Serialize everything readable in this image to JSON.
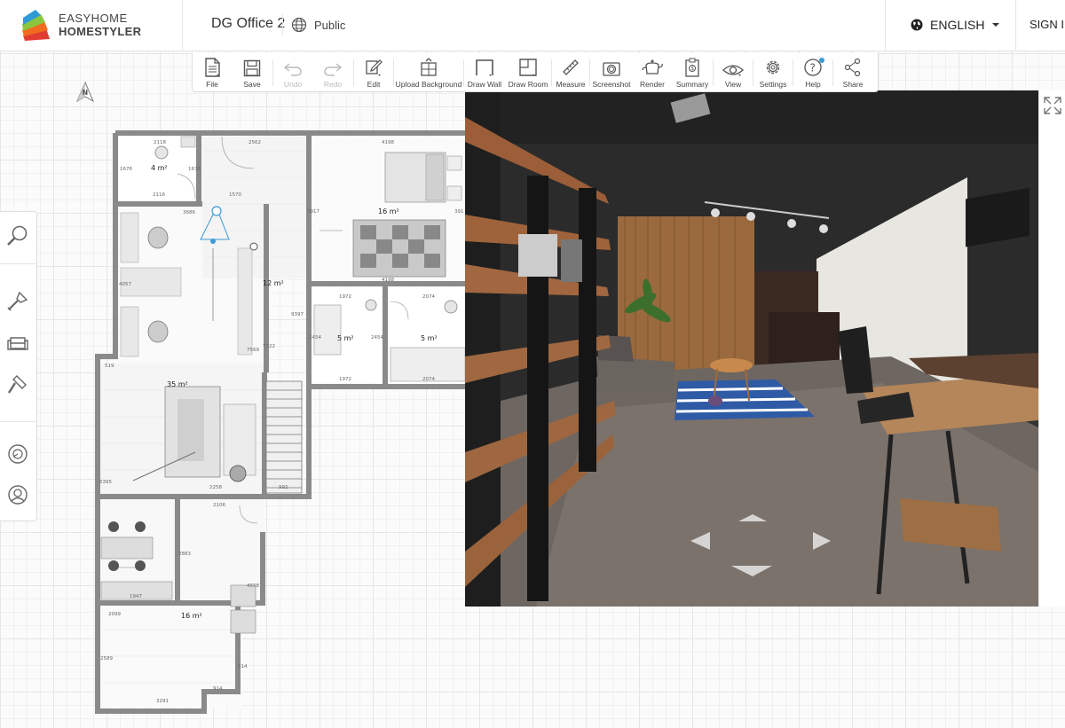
{
  "brand": {
    "line1": "EASYHOME",
    "line2": "HOMESTYLER"
  },
  "header": {
    "design_name": "DG Office 2",
    "visibility": "Public",
    "language": "ENGLISH",
    "sign_in": "SIGN I"
  },
  "toolbar": {
    "file": "File",
    "save": "Save",
    "undo": "Undo",
    "redo": "Redo",
    "edit": "Edit",
    "upload_background": "Upload Background",
    "draw_wall": "Draw Wall",
    "draw_room": "Draw Room",
    "measure": "Measure",
    "screenshot": "Screenshot",
    "render": "Render",
    "summary": "Summary",
    "view": "View",
    "settings": "Settings",
    "help": "Help",
    "share": "Share"
  },
  "compass_label": "N",
  "rooms": {
    "r4": "4 m²",
    "r16a": "16 m²",
    "r12": "12 m²",
    "r5a": "5 m²",
    "r5b": "5 m²",
    "r35": "35 m²",
    "r16b": "16 m²"
  },
  "dims": {
    "d2118": "2118",
    "d2562": "2562",
    "d4198a": "4198",
    "d1676a": "1676",
    "d1676b": "1676",
    "d2116": "2116",
    "d1570": "1570",
    "d3686": "3686",
    "d3917": "3917",
    "d391": "391",
    "d4057": "4057",
    "d4198b": "4198",
    "d1972a": "1972",
    "d2074a": "2074",
    "d9397": "9397",
    "d7569": "7569",
    "d7722": "7722",
    "d2454a": "2454",
    "d2454b": "2454",
    "d519": "519",
    "d1972b": "1972",
    "d2074b": "2074",
    "d6395": "6395",
    "d2258": "2258",
    "d992": "992",
    "d2106": "2106",
    "d2883": "2883",
    "d4558": "4558",
    "d1947": "1947",
    "d2099": "2099",
    "d2589": "2589",
    "d914a": "914",
    "d914b": "914",
    "d3291": "3291"
  },
  "colors": {
    "accent_blue": "#3a9ad9",
    "wall_gray": "#8a8a8a",
    "logo_orange": "#f26b21",
    "logo_green": "#8cc63f",
    "logo_blue": "#2e9bd6",
    "logo_red": "#e03c31"
  }
}
